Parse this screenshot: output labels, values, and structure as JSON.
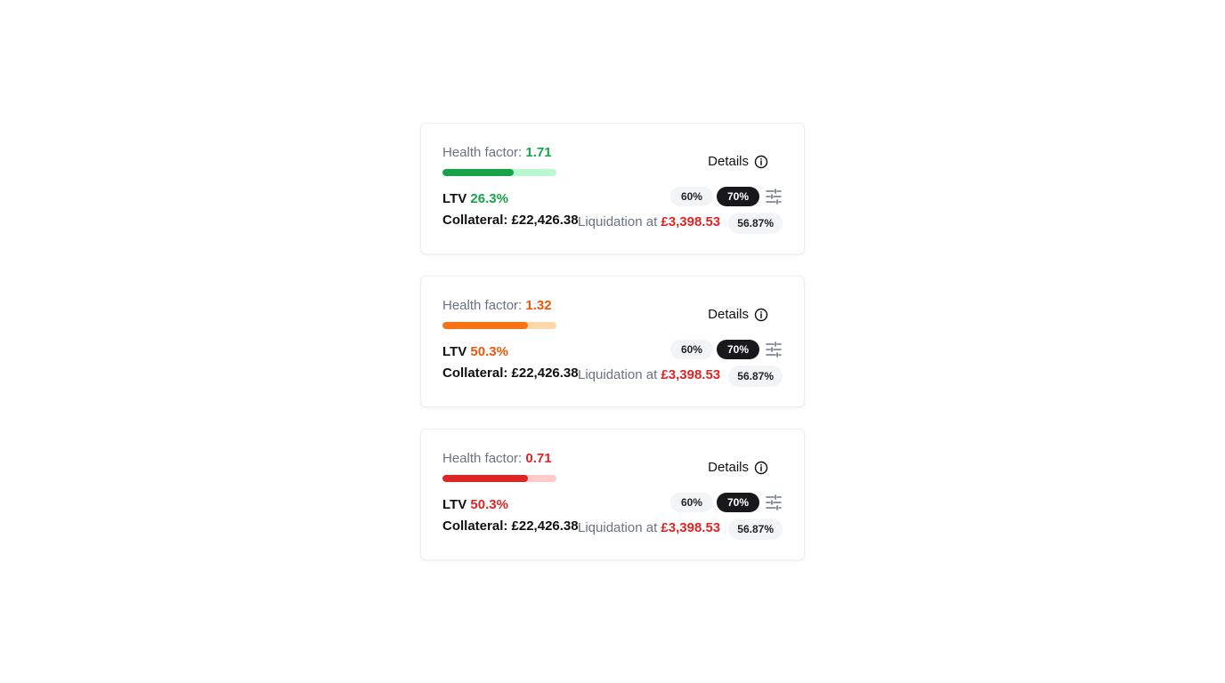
{
  "cards": [
    {
      "health_label": "Health factor:",
      "health_value": "1.71",
      "health_color": "#16a34a",
      "health_fill": 0.625,
      "bar_color": "#16a34a",
      "bar_track": "#bbf7d0",
      "details_label": "Details",
      "ltv_label": "LTV",
      "ltv_value": "26.3%",
      "ltv_color": "#16a34a",
      "collateral_label": "Collateral:",
      "collateral_value": "£22,426.38",
      "liquidation_label": "Liquidation at",
      "liquidation_price": "£3,398.53",
      "liquidation_pct": "56.87%",
      "ltv_options": [
        "60%",
        "70%"
      ],
      "selected_option": "70%",
      "settings_icon": "sliders-icon",
      "info_icon": "info-circle-icon"
    },
    {
      "health_label": "Health factor:",
      "health_value": "1.32",
      "health_color": "#ea580c",
      "health_fill": 0.75,
      "bar_color": "#f97316",
      "bar_track": "#fed7aa",
      "details_label": "Details",
      "ltv_label": "LTV",
      "ltv_value": "50.3%",
      "ltv_color": "#ea580c",
      "collateral_label": "Collateral:",
      "collateral_value": "£22,426.38",
      "liquidation_label": "Liquidation at",
      "liquidation_price": "£3,398.53",
      "liquidation_pct": "56.87%",
      "ltv_options": [
        "60%",
        "70%"
      ],
      "selected_option": "70%",
      "settings_icon": "sliders-icon",
      "info_icon": "info-circle-icon"
    },
    {
      "health_label": "Health factor:",
      "health_value": "0.71",
      "health_color": "#dc2626",
      "health_fill": 0.75,
      "bar_color": "#dc2626",
      "bar_track": "#fecaca",
      "details_label": "Details",
      "ltv_label": "LTV",
      "ltv_value": "50.3%",
      "ltv_color": "#dc2626",
      "collateral_label": "Collateral:",
      "collateral_value": "£22,426.38",
      "liquidation_label": "Liquidation at",
      "liquidation_price": "£3,398.53",
      "liquidation_pct": "56.87%",
      "ltv_options": [
        "60%",
        "70%"
      ],
      "selected_option": "70%",
      "settings_icon": "sliders-icon",
      "info_icon": "info-circle-icon"
    }
  ]
}
